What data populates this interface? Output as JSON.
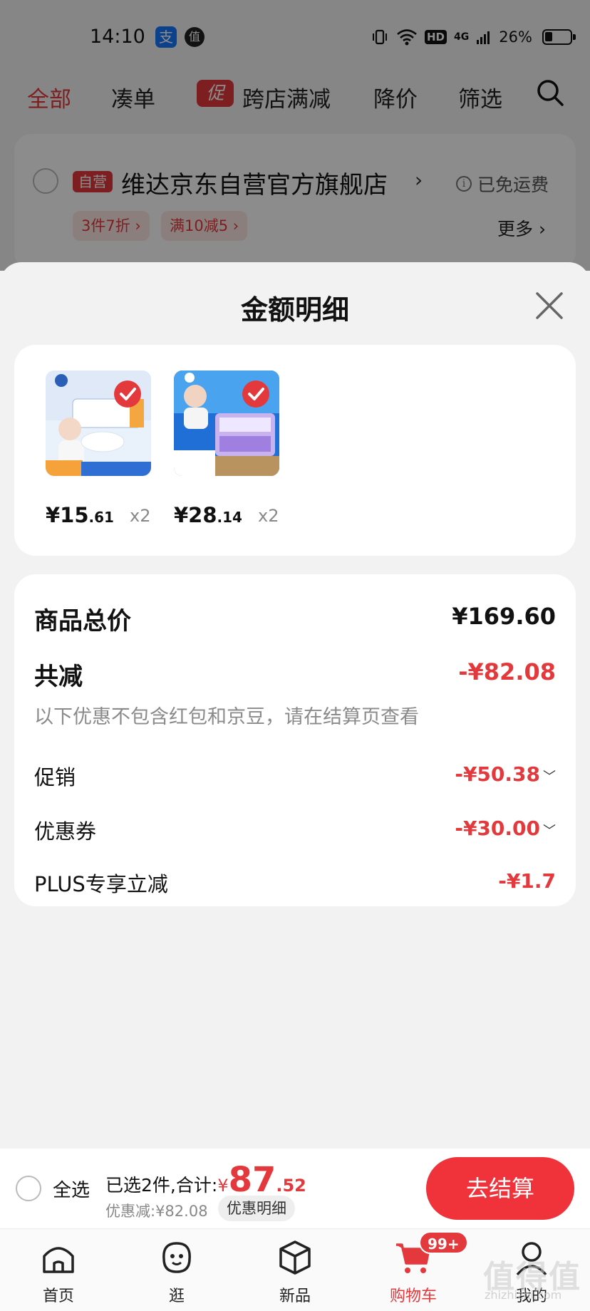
{
  "status_bar": {
    "time": "14:10",
    "app1": "支",
    "app2": "值",
    "hd": "HD",
    "net": "4G",
    "battery": "26%"
  },
  "top_tabs": {
    "all": "全部",
    "bundle": "凑单",
    "promo_badge": "促",
    "cross_store": "跨店满减",
    "price_drop": "降价",
    "filter": "筛选"
  },
  "store": {
    "badge": "自营",
    "name": "维达京东自营官方旗舰店",
    "shipping": "已免运费",
    "promos": [
      "3件7折 ›",
      "满10减5 ›"
    ],
    "more": "更多 ›"
  },
  "sheet": {
    "title": "金额明细",
    "products": [
      {
        "price_int": "¥15",
        "price_dec": ".61",
        "qty": "x2"
      },
      {
        "price_int": "¥28",
        "price_dec": ".14",
        "qty": "x2"
      }
    ],
    "summary": {
      "total_label": "商品总价",
      "total_value": "¥169.60",
      "reduce_label": "共减",
      "reduce_value": "-¥82.08",
      "note": "以下优惠不包含红包和京豆，请在结算页查看",
      "promo_label": "促销",
      "promo_value": "-¥50.38",
      "coupon_label": "优惠券",
      "coupon_value": "-¥30.00",
      "plus_label": "PLUS专享立减",
      "plus_value": "-¥1.7"
    }
  },
  "checkout": {
    "select_all": "全选",
    "selected_text": "已选2件,合计:",
    "currency": "¥",
    "total_int": "87",
    "total_dec": ".52",
    "discount_text": "优惠减:¥82.08",
    "detail_button": "优惠明细",
    "checkout_button": "去结算"
  },
  "bottom_nav": {
    "home": "首页",
    "browse": "逛",
    "new": "新品",
    "cart": "购物车",
    "me": "我的",
    "cart_badge": "99+"
  },
  "watermark": {
    "text": "值得值",
    "url": "zhizhizhi.com"
  },
  "colors": {
    "accent": "#e4393c",
    "checkout_button": "#f0333a"
  }
}
